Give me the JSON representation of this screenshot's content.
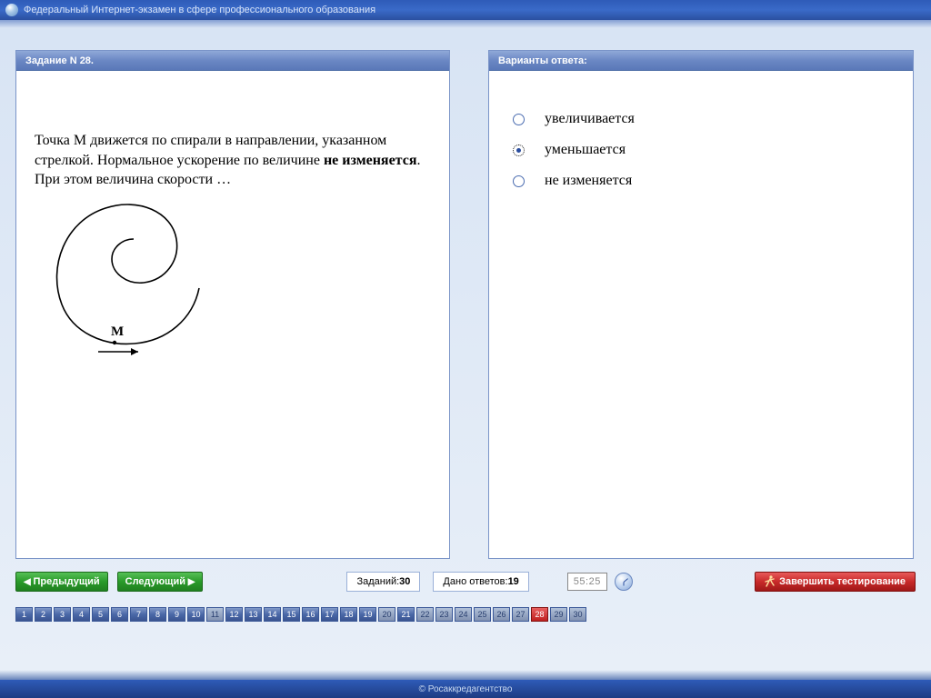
{
  "titlebar": {
    "text": "Федеральный Интернет-экзамен в сфере профессионального образования"
  },
  "question_panel": {
    "header": "Задание N 28.",
    "text_before_bold": "Точка М движется по спирали в направлении, указанном стрелкой. Нормальное ускорение по величине ",
    "text_bold": "не изменяется",
    "text_after_bold": ". При этом величина скорости …",
    "point_label": "M"
  },
  "answers_panel": {
    "header": "Варианты ответа:",
    "options": [
      {
        "label": "увеличивается",
        "selected": false
      },
      {
        "label": "уменьшается",
        "selected": true
      },
      {
        "label": "не изменяется",
        "selected": false
      }
    ]
  },
  "nav": {
    "prev": "Предыдущий",
    "next": "Следующий",
    "tasks_label": "Заданий: ",
    "tasks_value": "30",
    "answered_label": "Дано ответов:",
    "answered_value": "19",
    "timer": "55:25",
    "finish": "Завершить тестирование"
  },
  "pager": {
    "count": 30,
    "current": 28,
    "light": [
      11,
      20,
      22,
      23,
      24,
      25,
      26,
      27,
      29,
      30
    ]
  },
  "footer": {
    "text": "© Росаккредагентство"
  }
}
